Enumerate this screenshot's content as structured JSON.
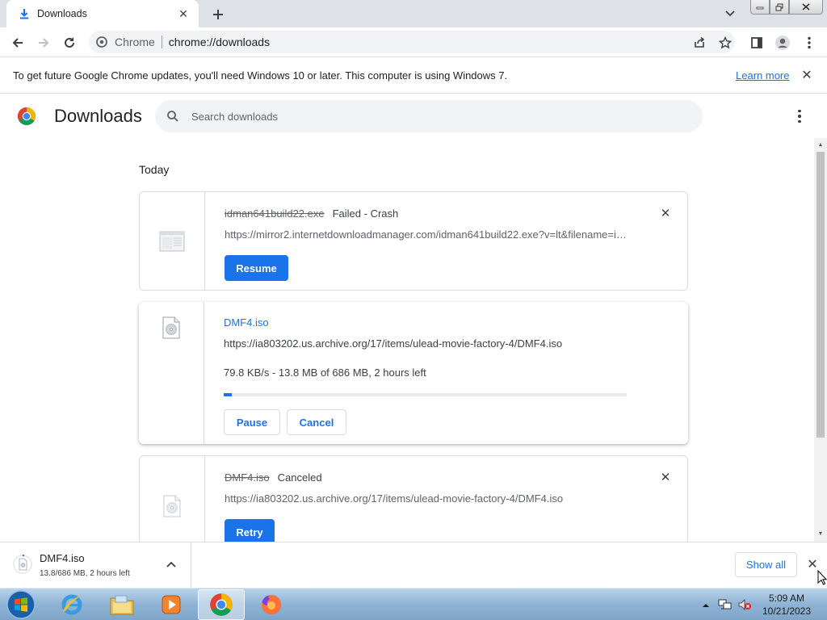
{
  "tab": {
    "title": "Downloads",
    "icon": "download-icon"
  },
  "toolbar": {
    "site_name": "Chrome",
    "url": "chrome://downloads"
  },
  "infobar": {
    "message": "To get future Google Chrome updates, you'll need Windows 10 or later. This computer is using Windows 7.",
    "learn_more": "Learn more"
  },
  "page": {
    "title": "Downloads",
    "search_placeholder": "Search downloads",
    "date_group": "Today"
  },
  "downloads": [
    {
      "filename": "idman641build22.exe",
      "status": "Failed - Crash",
      "url": "https://mirror2.internetdownloadmanager.com/idman641build22.exe?v=lt&filename=idman641build22.exe",
      "action": "Resume"
    },
    {
      "filename": "DMF4.iso",
      "url": "https://ia803202.us.archive.org/17/items/ulead-movie-factory-4/DMF4.iso",
      "progress_text": "79.8 KB/s - 13.8 MB of 686 MB, 2 hours left",
      "progress_fraction": 0.02,
      "pause": "Pause",
      "cancel": "Cancel"
    },
    {
      "filename": "DMF4.iso",
      "status": "Canceled",
      "url": "https://ia803202.us.archive.org/17/items/ulead-movie-factory-4/DMF4.iso",
      "action": "Retry"
    }
  ],
  "shelf": {
    "filename": "DMF4.iso",
    "status": "13.8/686 MB, 2 hours left",
    "show_all": "Show all"
  },
  "taskbar": {
    "time": "5:09 AM",
    "date": "10/21/2023"
  },
  "colors": {
    "accent": "#1a73e8",
    "text": "#202124",
    "muted": "#5f6368"
  }
}
